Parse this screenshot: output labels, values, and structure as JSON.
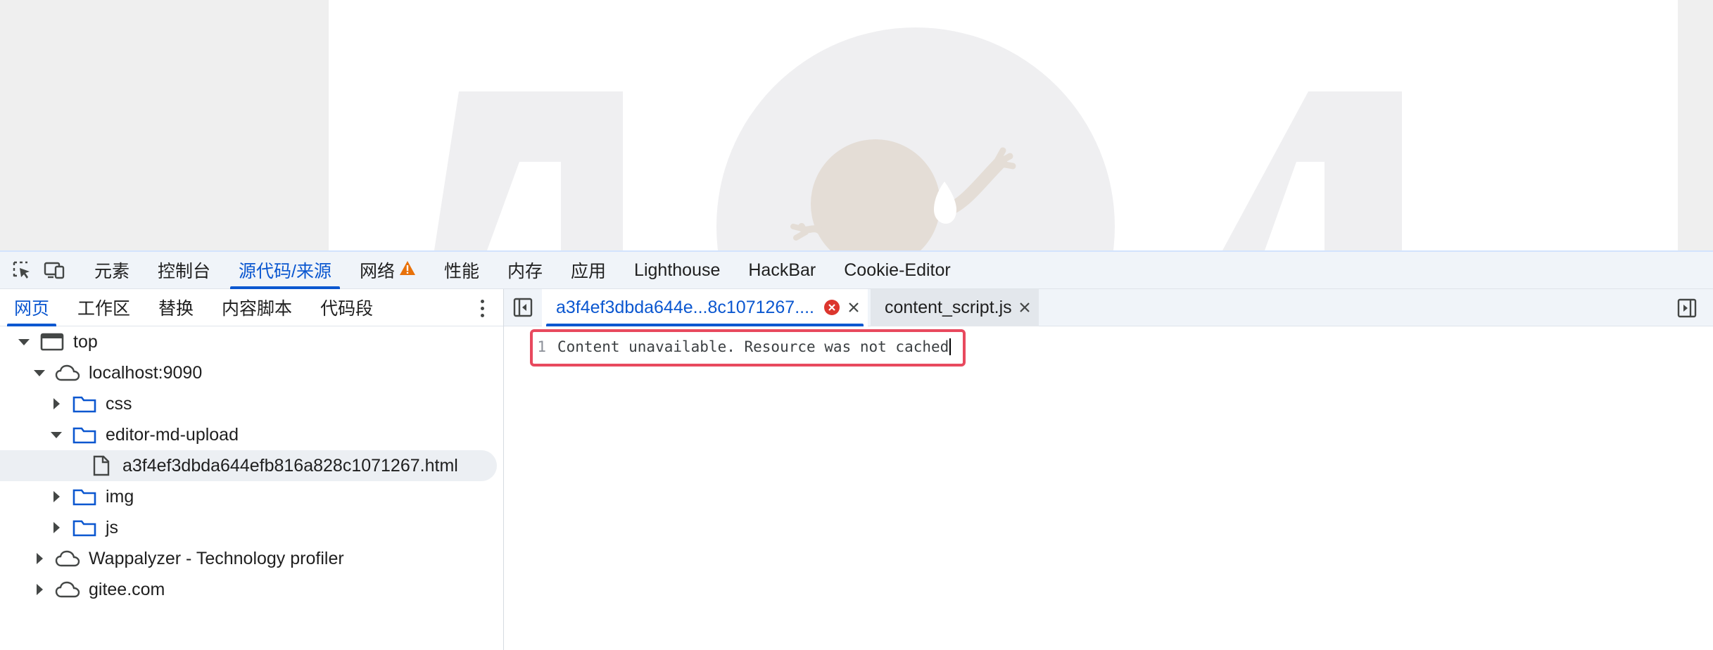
{
  "page": {
    "illustration": "404-not-found-illustration"
  },
  "devtools": {
    "toolbar": {
      "inspect_icon": "inspect-element-icon",
      "device_icon": "device-toolbar-icon",
      "tabs": [
        {
          "label": "元素",
          "active": false
        },
        {
          "label": "控制台",
          "active": false
        },
        {
          "label": "源代码/来源",
          "active": true
        },
        {
          "label": "网络",
          "active": false,
          "warning": true
        },
        {
          "label": "性能",
          "active": false
        },
        {
          "label": "内存",
          "active": false
        },
        {
          "label": "应用",
          "active": false
        },
        {
          "label": "Lighthouse",
          "active": false
        },
        {
          "label": "HackBar",
          "active": false
        },
        {
          "label": "Cookie-Editor",
          "active": false
        }
      ],
      "accent_color": "#0b57d0",
      "warning_color": "#e8710a"
    },
    "navigator": {
      "tabs": [
        {
          "label": "网页",
          "active": true
        },
        {
          "label": "工作区",
          "active": false
        },
        {
          "label": "替换",
          "active": false
        },
        {
          "label": "内容脚本",
          "active": false
        },
        {
          "label": "代码段",
          "active": false
        }
      ],
      "tree": [
        {
          "label": "top",
          "icon": "frame-icon",
          "expanded": true
        },
        {
          "label": "localhost:9090",
          "icon": "cloud-icon",
          "expanded": true
        },
        {
          "label": "css",
          "icon": "folder-icon",
          "expanded": false
        },
        {
          "label": "editor-md-upload",
          "icon": "folder-icon",
          "expanded": true
        },
        {
          "label": "a3f4ef3dbda644efb816a828c1071267.html",
          "icon": "file-icon",
          "selected": true
        },
        {
          "label": "img",
          "icon": "folder-icon",
          "expanded": false
        },
        {
          "label": "js",
          "icon": "folder-icon",
          "expanded": false
        },
        {
          "label": "Wappalyzer - Technology profiler",
          "icon": "cloud-icon",
          "expanded": false
        },
        {
          "label": "gitee.com",
          "icon": "cloud-icon",
          "expanded": false
        }
      ]
    },
    "editor": {
      "tabs": [
        {
          "label": "a3f4ef3dbda644e...8c1071267....",
          "active": true,
          "error": true
        },
        {
          "label": "content_script.js",
          "active": false
        }
      ],
      "lines": [
        {
          "number": "1",
          "text": "Content unavailable. Resource was not cached"
        }
      ],
      "highlight_color": "#e8495e"
    }
  }
}
